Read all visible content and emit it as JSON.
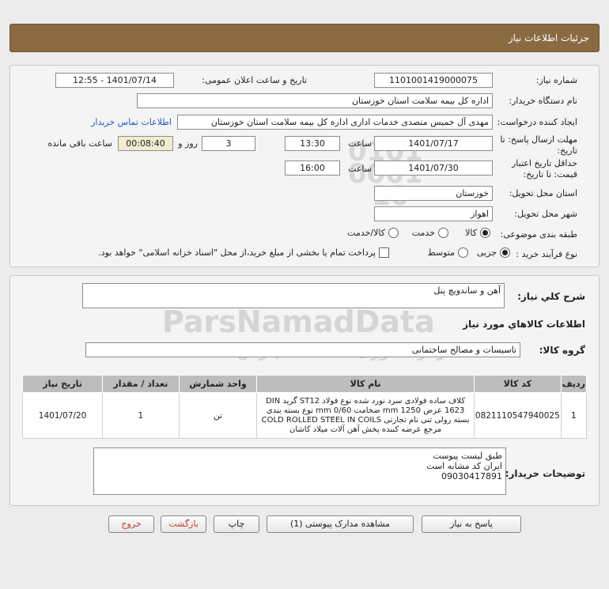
{
  "header": {
    "title": "جزئیات اطلاعات نیاز"
  },
  "form": {
    "need_number_label": "شماره نیاز:",
    "need_number": "1101001419000075",
    "announce_label": "تاریخ و ساعت اعلان عمومی:",
    "announce_value": "1401/07/14 - 12:55",
    "buyer_org_label": "نام دستگاه خریدار:",
    "buyer_org": "اداره کل بیمه سلامت استان خوزستان",
    "requester_label": "ایجاد کننده درخواست:",
    "requester": "مهدی آل خمیس متصدی خدمات اداری اداره کل بیمه سلامت استان خوزستان",
    "contact_link": "اطلاعات تماس خریدار",
    "deadline_label_1": "مهلت ارسال پاسخ: تا",
    "deadline_label_2": "تاریخ:",
    "deadline_date": "1401/07/17",
    "time_word": "ساعت",
    "deadline_time": "13:30",
    "days_value": "3",
    "days_word": "روز و",
    "remaining_time": "00:08:40",
    "remaining_word": "ساعت باقی مانده",
    "validity_label_1": "حداقل تاریخ اعتبار",
    "validity_label_2": "قیمت: تا تاریخ:",
    "validity_date": "1401/07/30",
    "validity_time": "16:00",
    "province_label": "استان محل تحویل:",
    "province": "خوزستان",
    "city_label": "شهر محل تحویل:",
    "city": "اهواز",
    "category_label": "طبقه بندی موضوعی:",
    "category_options": [
      "کالا",
      "خدمت",
      "کالا/خدمت"
    ],
    "process_label": "نوع فرآیند خرید :",
    "process_options": [
      "جزیی",
      "متوسط"
    ],
    "payment_note": "پرداخت تمام یا بخشی از مبلغ خرید،از محل \"اسناد خزانه اسلامی\" خواهد بود."
  },
  "summary": {
    "general_desc_label": "شرح کلي نياز:",
    "general_desc": "آهن و ساندویچ پنل",
    "goods_info_title": "اطلاعات کالاهاي مورد نياز",
    "goods_group_label": "گروه کالا:",
    "goods_group": "تاسیسات و مصالح ساختمانی"
  },
  "table": {
    "headers": [
      "ردیف",
      "کد کالا",
      "نام کالا",
      "واحد شمارش",
      "تعداد / مقدار",
      "تاریخ نیاز"
    ],
    "rows": [
      {
        "index": "1",
        "code": "0821110547940025",
        "name_lines": [
          "کلاف ساده فولادی سرد نورد شده نوع فولاد ST12 گرید DIN",
          "1623 عرض mm 1250 ضخامت mm 0/60 نوع بسته بندی",
          "بسته رولی تنی نام تجارتی COLD ROLLED STEEL IN COILS",
          "مرجع عرضه کننده پخش آهن آلات میلاد کاشان"
        ],
        "unit": "تن",
        "qty": "1",
        "date": "1401/07/20"
      }
    ]
  },
  "buyer_notes": {
    "label": "توضیحات خریدار:",
    "lines": [
      "طبق لیست پیوست",
      "ایران کد مشابه است",
      "09030417891"
    ]
  },
  "buttons": {
    "reply": "پاسخ به نیاز",
    "attachments": "مشاهده مدارک پیوستی (1)",
    "print": "چاپ",
    "back": "بازگشت",
    "exit": "خروج"
  },
  "watermark": {
    "brand": "ParsNamadData",
    "fa_line1": "پایگاه داده رسانی مناقصه و مزایده",
    "fa_line2": "مرکز فناوری اطلاعات پارس نماد داده",
    "phone": "۰۲۱-۸۸۳۴۹۶۷۰",
    "digits": [
      "0101",
      "0001",
      "10"
    ]
  },
  "colors": {
    "header_bg": "#8a6a41",
    "link": "#1f58c8",
    "table_header_bg": "#bdbdbd"
  }
}
